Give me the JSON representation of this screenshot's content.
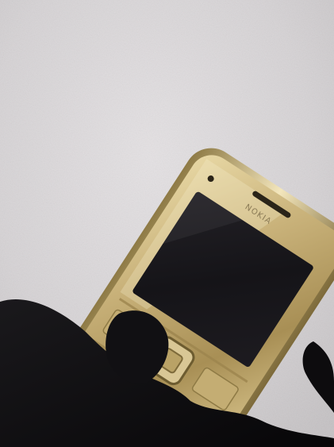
{
  "photo": {
    "subject": "gold-mobile-phone-in-gloved-hand",
    "background_color": "#d9d6d8",
    "glove_color": "#0d0c0e",
    "phone_gold": "#c9b27a",
    "phone_gold_dark": "#8e7a45",
    "screen_color": "#17161a"
  },
  "phone": {
    "brand_label": "NOKIA",
    "icons": [
      "earpiece-slot-icon",
      "front-camera-icon",
      "navigation-dpad-icon"
    ]
  }
}
